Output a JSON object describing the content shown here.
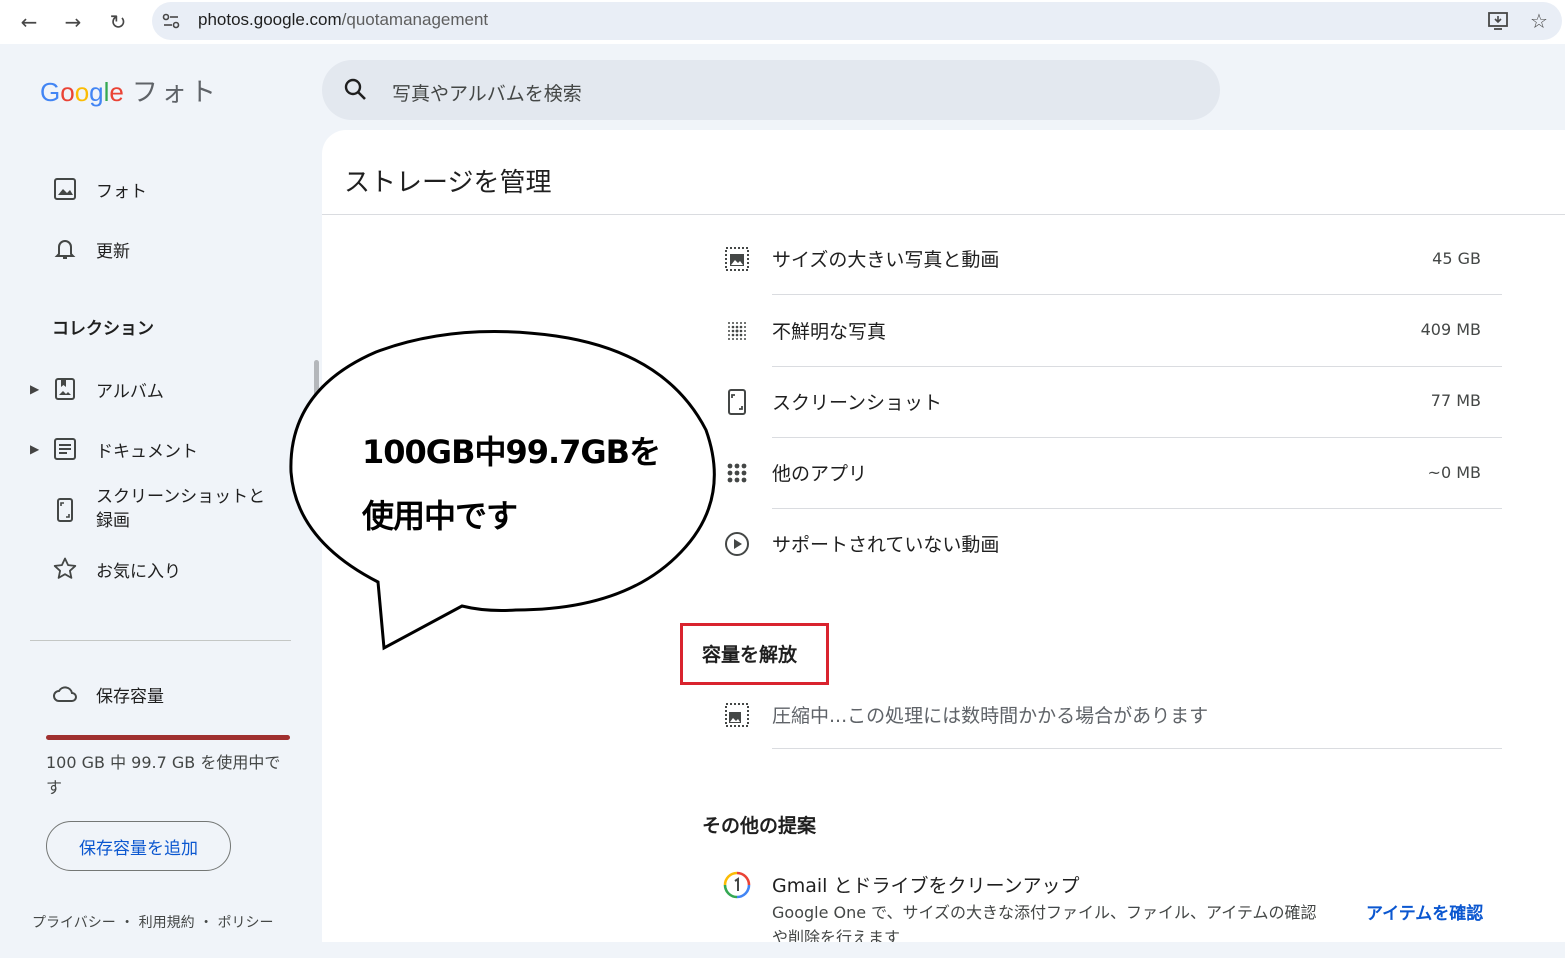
{
  "browser": {
    "url_host": "photos.google.com",
    "url_path": "/quotamanagement"
  },
  "app": {
    "logo_letters": [
      "G",
      "o",
      "o",
      "g",
      "l",
      "e"
    ],
    "logo_suffix": "フォト"
  },
  "search": {
    "placeholder": "写真やアルバムを検索"
  },
  "sidebar": {
    "items": [
      {
        "label": "フォト",
        "icon": "photo-icon"
      },
      {
        "label": "更新",
        "icon": "bell-icon"
      }
    ],
    "collections_title": "コレクション",
    "collections": [
      {
        "label": "アルバム",
        "icon": "album-icon"
      },
      {
        "label": "ドキュメント",
        "icon": "document-icon"
      },
      {
        "label_line1": "スクリーンショットと",
        "label_line2": "録画",
        "icon": "screenshot-icon"
      },
      {
        "label": "お気に入り",
        "icon": "star-icon"
      }
    ],
    "storage": {
      "label": "保存容量",
      "used_fraction": 0.997,
      "usage_text": "100 GB 中 99.7 GB を使用中です",
      "add_button": "保存容量を追加",
      "bar_color": "#a03030"
    },
    "footer": "プライバシー ・ 利用規約 ・ ポリシー"
  },
  "main": {
    "title": "ストレージを管理",
    "review_rows": [
      {
        "label": "サイズの大きい写真と動画",
        "value": "45 GB",
        "icon": "large-photo-icon"
      },
      {
        "label": "不鮮明な写真",
        "value": "409 MB",
        "icon": "blurry-icon"
      },
      {
        "label": "スクリーンショット",
        "value": "77 MB",
        "icon": "screenshot-icon"
      },
      {
        "label": "他のアプリ",
        "value": "~0 MB",
        "icon": "apps-grid-icon"
      },
      {
        "label": "サポートされていない動画",
        "value": "",
        "icon": "play-circle-icon"
      }
    ],
    "free_space": {
      "title": "容量を解放",
      "compress_text": "圧縮中...この処理には数時間かかる場合があります",
      "highlight_color": "#d9232e"
    },
    "other": {
      "title": "その他の提案",
      "gmail_title": "Gmail とドライブをクリーンアップ",
      "gmail_desc": "Google One で、サイズの大きな添付ファイル、ファイル、アイテムの確認や削除を行えます",
      "link": "アイテムを確認"
    }
  },
  "callout": {
    "line1": "100GB中99.7GBを",
    "line2": "使用中です"
  }
}
